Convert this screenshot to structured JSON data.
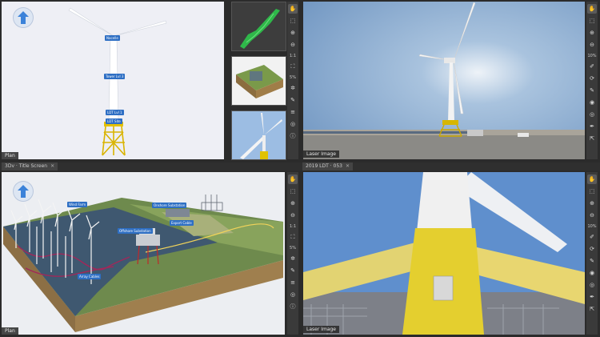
{
  "tabs": {
    "left_title": "3Dv · Title Screen",
    "right_title": "2019 LDT · 053"
  },
  "views": {
    "plan_top_label": "Plan",
    "plan_bottom_label": "Plan",
    "laser_top_label": "Laser Image",
    "laser_bottom_label": "Laser Image"
  },
  "turbine_callouts": {
    "nacelle": "Nacelle",
    "tower": "Tower Lvl 3",
    "ldt1": "LDT Lvl 1",
    "ldt_site": "LDT Site"
  },
  "map_callouts": {
    "c1": "Wind Farm",
    "c2": "Offshore Substation",
    "c3": "Onshore Substation",
    "c4": "Export Cable",
    "c5": "Array Cables"
  },
  "toolbar": {
    "scale_1to1": "1:1",
    "zoom_pct_top": "10%",
    "zoom_pct_left": "5%",
    "zoom_pct_bottom": "5%",
    "zoom_pct_right_bottom": "10%"
  }
}
